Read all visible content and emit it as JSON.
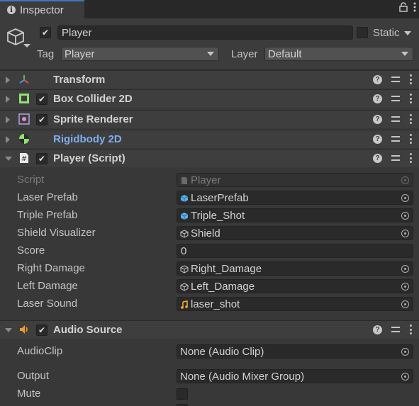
{
  "tab": {
    "title": "Inspector"
  },
  "header": {
    "object_name": "Player",
    "static_label": "Static",
    "tag_label": "Tag",
    "tag_value": "Player",
    "layer_label": "Layer",
    "layer_value": "Default"
  },
  "components": [
    {
      "name": "Transform",
      "has_checkbox": false,
      "expanded": false
    },
    {
      "name": "Box Collider 2D",
      "has_checkbox": true,
      "expanded": false
    },
    {
      "name": "Sprite Renderer",
      "has_checkbox": true,
      "expanded": false
    },
    {
      "name": "Rigidbody 2D",
      "has_checkbox": false,
      "expanded": false
    },
    {
      "name": "Player (Script)",
      "has_checkbox": true,
      "expanded": true
    },
    {
      "name": "Audio Source",
      "has_checkbox": true,
      "expanded": true
    }
  ],
  "script_props": [
    {
      "label": "Script",
      "value": "Player",
      "icon": "script-icon"
    },
    {
      "label": "Laser Prefab",
      "value": "LaserPrefab",
      "icon": "prefab-icon"
    },
    {
      "label": "Triple Prefab",
      "value": "Triple_Shot",
      "icon": "prefab-icon"
    },
    {
      "label": "Shield Visualizer",
      "value": "Shield",
      "icon": "gameobject-icon"
    },
    {
      "label": "Score",
      "value": "0",
      "icon": ""
    },
    {
      "label": "Right Damage",
      "value": "Right_Damage",
      "icon": "gameobject-icon"
    },
    {
      "label": "Left Damage",
      "value": "Left_Damage",
      "icon": "gameobject-icon"
    },
    {
      "label": "Laser Sound",
      "value": "laser_shot",
      "icon": "audio-icon"
    }
  ],
  "audio_props": [
    {
      "label": "AudioClip",
      "value": "None (Audio Clip)"
    },
    {
      "label": "Output",
      "value": "None (Audio Mixer Group)"
    },
    {
      "label": "Mute",
      "value": ""
    }
  ],
  "colors": {
    "accent": "#3a79bb",
    "rigidbody_link": "#7eaef0"
  }
}
